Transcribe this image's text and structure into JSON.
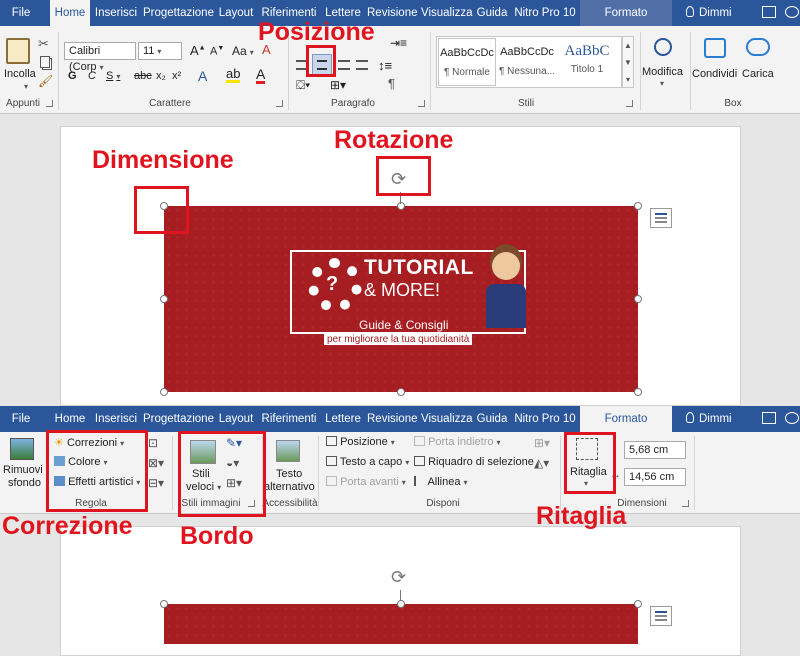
{
  "top": {
    "tabs": [
      "File",
      "Home",
      "Inserisci",
      "Progettazione",
      "Layout",
      "Riferimenti",
      "Lettere",
      "Revisione",
      "Visualizza",
      "Guida",
      "Nitro Pro 10"
    ],
    "context_tab": "Formato",
    "tell_me": "Dimmi",
    "clipboard": {
      "paste": "Incolla",
      "label": "Appunti"
    },
    "font": {
      "name": "Calibri (Corp",
      "size": "11",
      "bold": "G",
      "italic": "C",
      "underline": "S",
      "strike": "abc",
      "sub": "x₂",
      "sup": "x²",
      "grow": "A",
      "shrink": "A",
      "case": "Aa",
      "label": "Carattere"
    },
    "paragraph": {
      "label": "Paragrafo",
      "pilcrow": "¶"
    },
    "styles": {
      "label": "Stili",
      "items": [
        {
          "preview": "AaBbCcDc",
          "name": "¶ Normale"
        },
        {
          "preview": "AaBbCcDc",
          "name": "¶ Nessuna..."
        },
        {
          "preview": "AaBbC",
          "name": "Titolo 1"
        }
      ]
    },
    "editing": {
      "label": "Modifica"
    },
    "box": {
      "share": "Condividi",
      "upload": "Carica",
      "label": "Box"
    }
  },
  "bottom": {
    "tabs": [
      "File",
      "Home",
      "Inserisci",
      "Progettazione",
      "Layout",
      "Riferimenti",
      "Lettere",
      "Revisione",
      "Visualizza",
      "Guida",
      "Nitro Pro 10"
    ],
    "context_tab": "Formato",
    "tell_me": "Dimmi",
    "adjust": {
      "remove_bg_1": "Rimuovi",
      "remove_bg_2": "sfondo",
      "corrections": "Correzioni",
      "color": "Colore",
      "artistic": "Effetti artistici",
      "label": "Regola"
    },
    "picture_styles": {
      "quick_1": "Stili",
      "quick_2": "veloci",
      "label": "Stili immagini"
    },
    "accessibility": {
      "alt_1": "Testo",
      "alt_2": "alternativo",
      "label": "Accessibilità"
    },
    "arrange": {
      "position": "Posizione",
      "wrap": "Testo a capo",
      "forward": "Porta avanti",
      "backward": "Porta indietro",
      "selection": "Riquadro di selezione",
      "align": "Allinea",
      "label": "Disponi"
    },
    "size": {
      "crop": "Ritaglia",
      "height": "5,68 cm",
      "width": "14,56 cm",
      "label": "Dimensioni"
    }
  },
  "banner": {
    "title": "TUTORIAL",
    "subtitle": "& MORE!",
    "line1": "Guide & Consigli",
    "line2": "per migliorare la tua quotidianità"
  },
  "annotations": {
    "posizione": "Posizione",
    "rotazione": "Rotazione",
    "dimensione": "Dimensione",
    "correzione": "Correzione",
    "bordo": "Bordo",
    "ritaglia": "Ritaglia"
  },
  "colors": {
    "accent": "#2b579a",
    "banner": "#a61e22",
    "callout": "#e0141e"
  }
}
